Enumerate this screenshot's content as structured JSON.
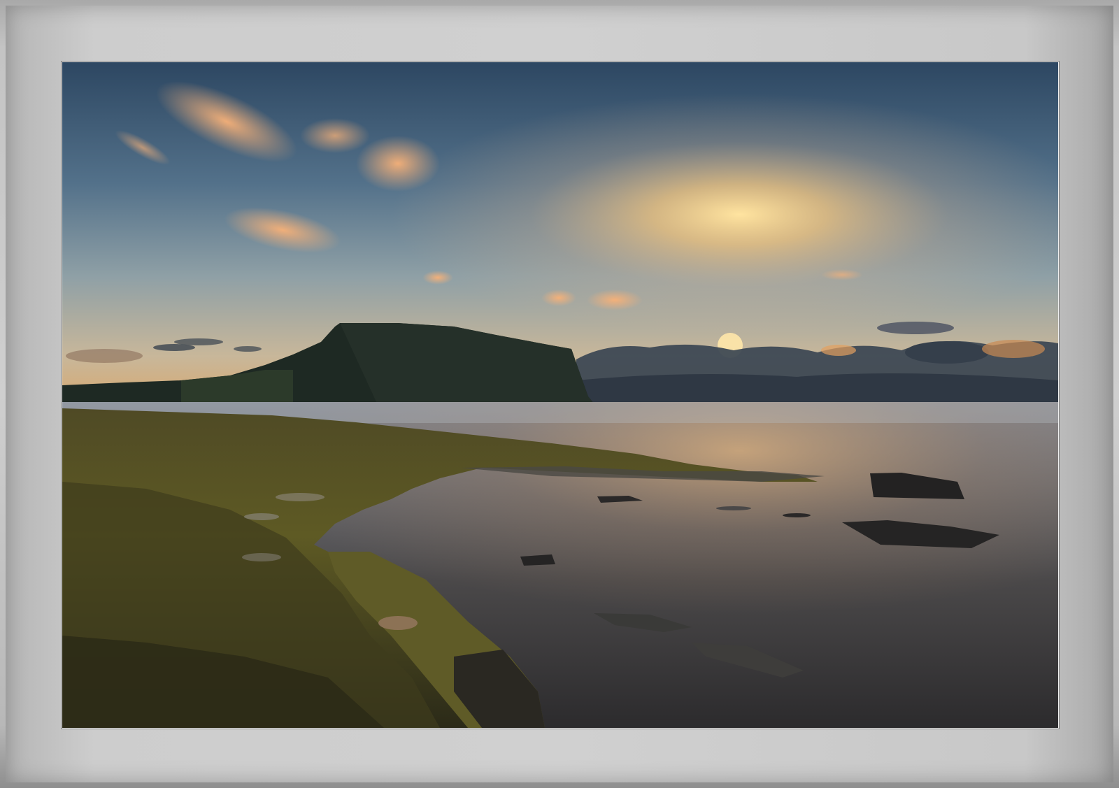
{
  "image": {
    "subject": "seascape-sunrise",
    "colors": {
      "frame": "#c9c9c9",
      "sky_top": "#2f4a66",
      "sky_horizon": "#f2c27a",
      "sun": "#ffd890",
      "water": "#3e3d40",
      "moss": "#5b5a22",
      "headland": "#1f2a22"
    }
  }
}
